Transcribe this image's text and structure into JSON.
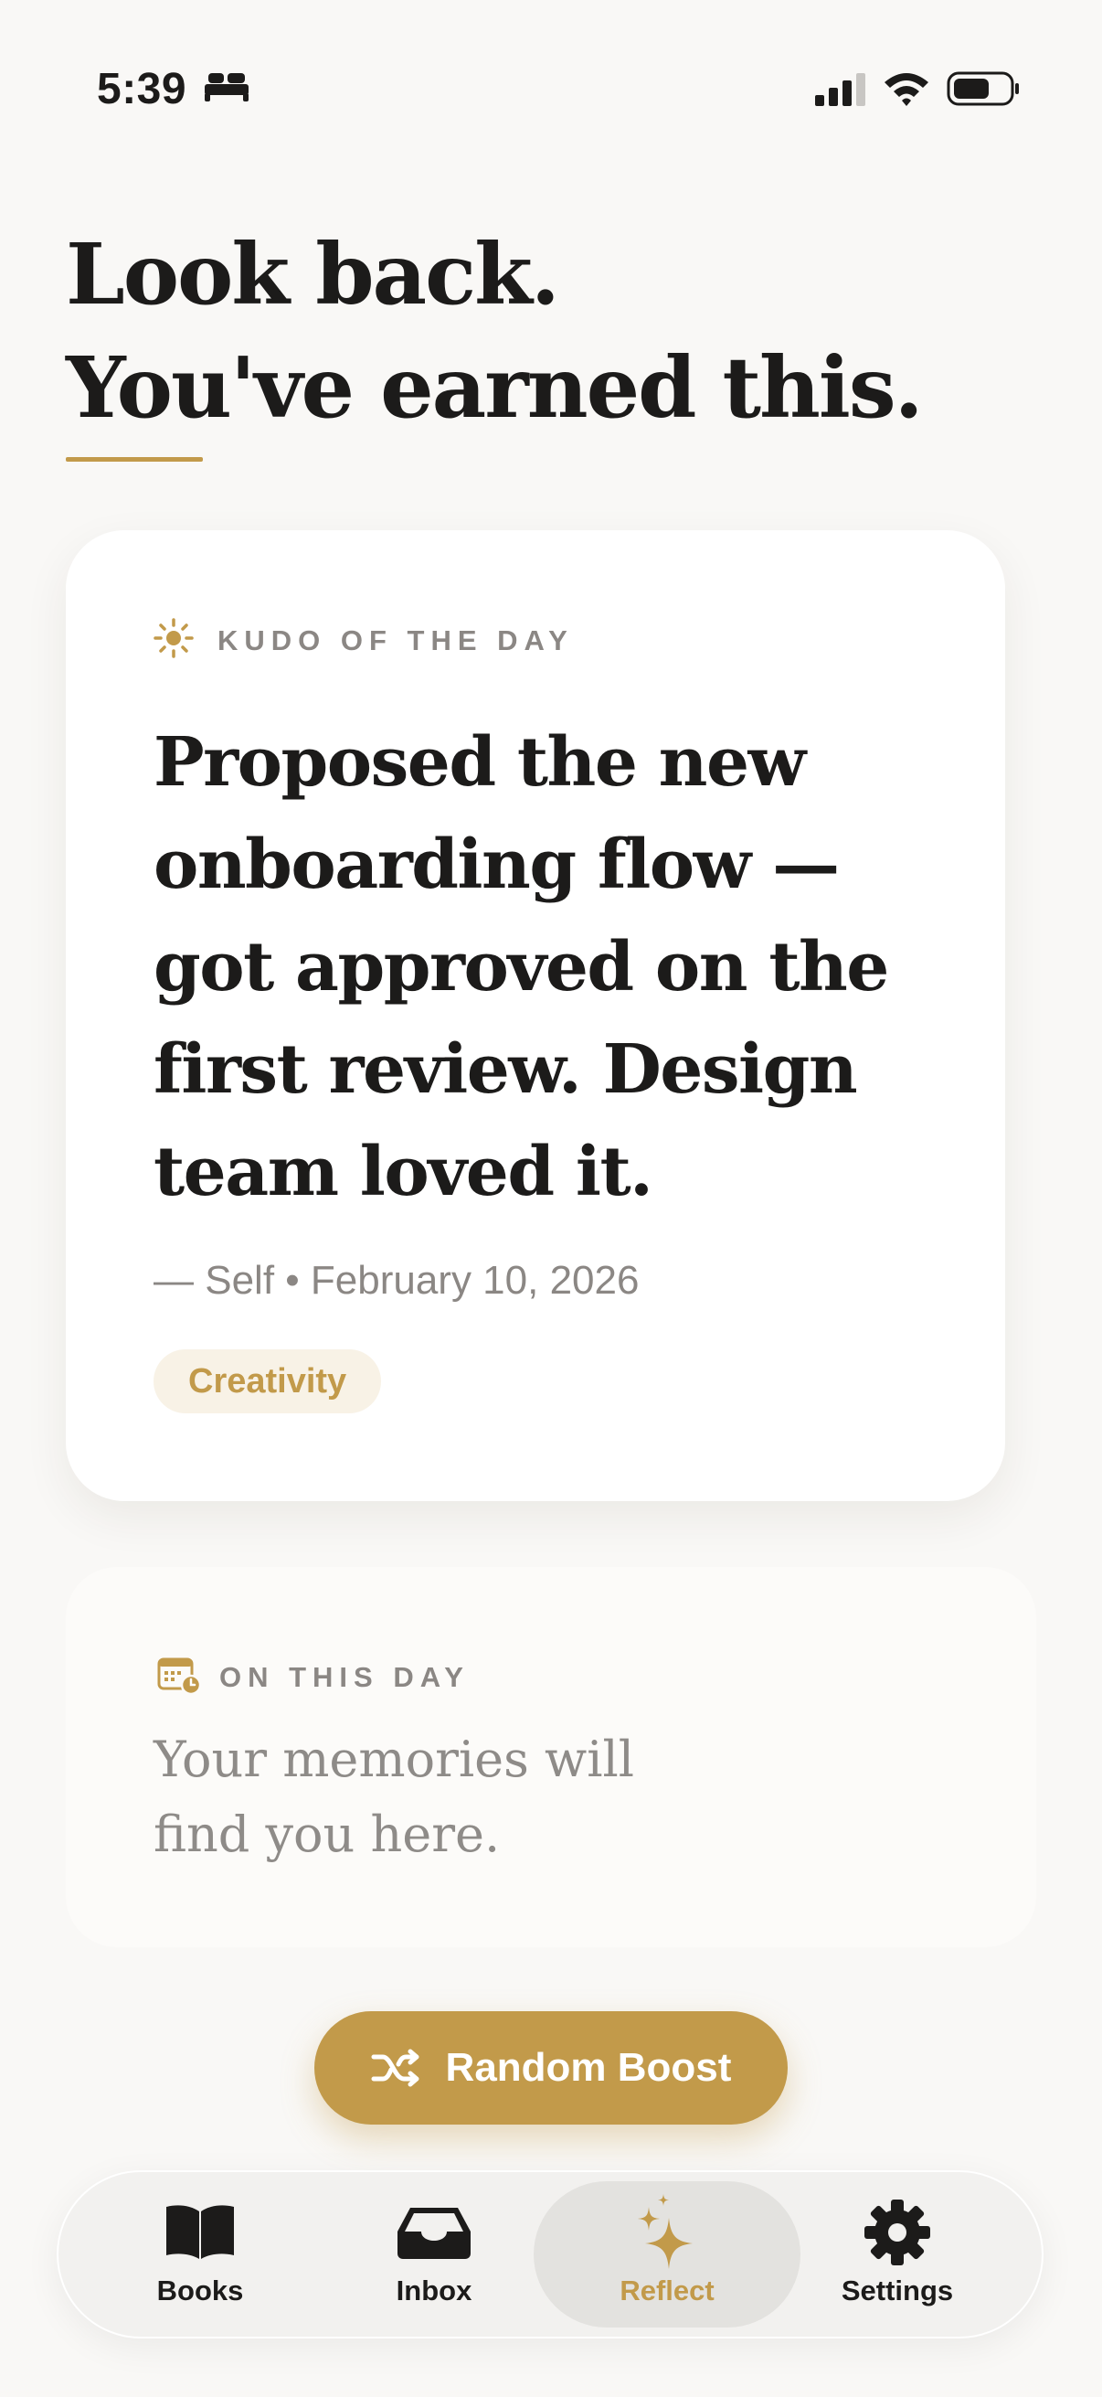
{
  "status_bar": {
    "time": "5:39",
    "icons": [
      "bed-icon",
      "cellular-signal-icon",
      "wifi-icon",
      "battery-icon"
    ]
  },
  "header": {
    "title_line1": "Look back.",
    "title_line2": "You've earned this."
  },
  "kudo_card": {
    "label": "KUDO OF THE DAY",
    "icon": "sun-icon",
    "text": "Proposed the new onboarding flow — got approved on the first review. Design team loved it.",
    "meta": "— Self • February 10, 2026",
    "tag": "Creativity"
  },
  "on_this_day": {
    "label": "ON THIS DAY",
    "icon": "calendar-clock-icon",
    "text": "Your memories will find you here."
  },
  "boost_button": {
    "label": "Random Boost",
    "icon": "shuffle-icon"
  },
  "tab_bar": {
    "tabs": [
      {
        "label": "Books",
        "icon": "book-icon",
        "active": false
      },
      {
        "label": "Inbox",
        "icon": "inbox-tray-icon",
        "active": false
      },
      {
        "label": "Reflect",
        "icon": "sparkles-icon",
        "active": true
      },
      {
        "label": "Settings",
        "icon": "gear-icon",
        "active": false
      }
    ]
  },
  "colors": {
    "background": "#F9F8F6",
    "accent": "#C29A4A",
    "text_primary": "#1C1B1A",
    "text_secondary": "#8B8784",
    "card": "#FFFFFF",
    "tag_background": "#F8F2E6"
  }
}
